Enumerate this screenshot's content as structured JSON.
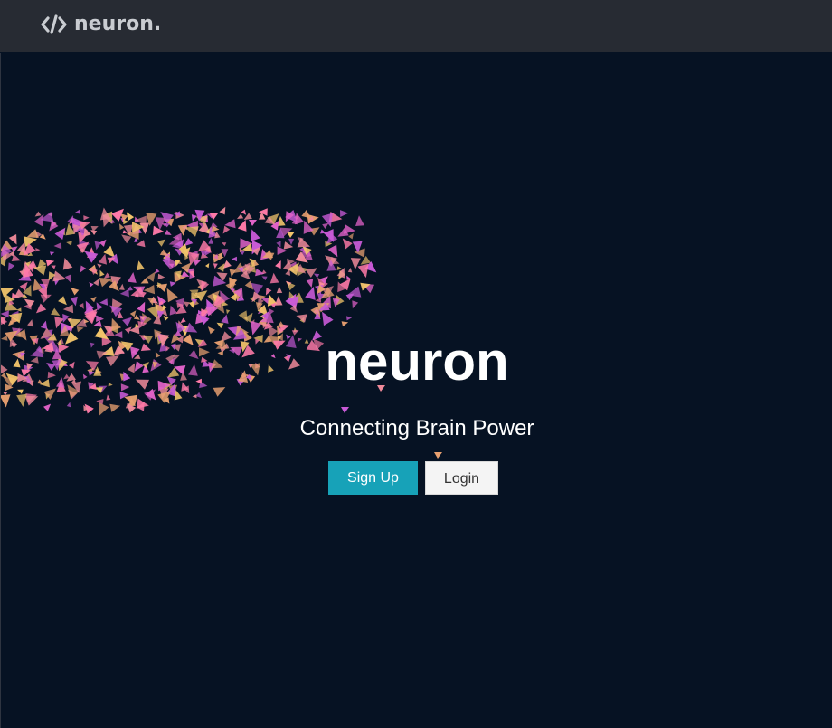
{
  "navbar": {
    "brand_icon": "code-icon",
    "brand_text": "neuron."
  },
  "hero": {
    "title": "neuron",
    "subtitle": "Connecting Brain Power",
    "signup_label": "Sign Up",
    "login_label": "Login"
  },
  "colors": {
    "background": "#061223",
    "navbar": "#272b33",
    "accent": "#17a2b8",
    "particle_palette": [
      "#e062c8",
      "#f08a9a",
      "#f3c56b",
      "#c85ad6",
      "#ff7aa8",
      "#e8a070"
    ]
  }
}
